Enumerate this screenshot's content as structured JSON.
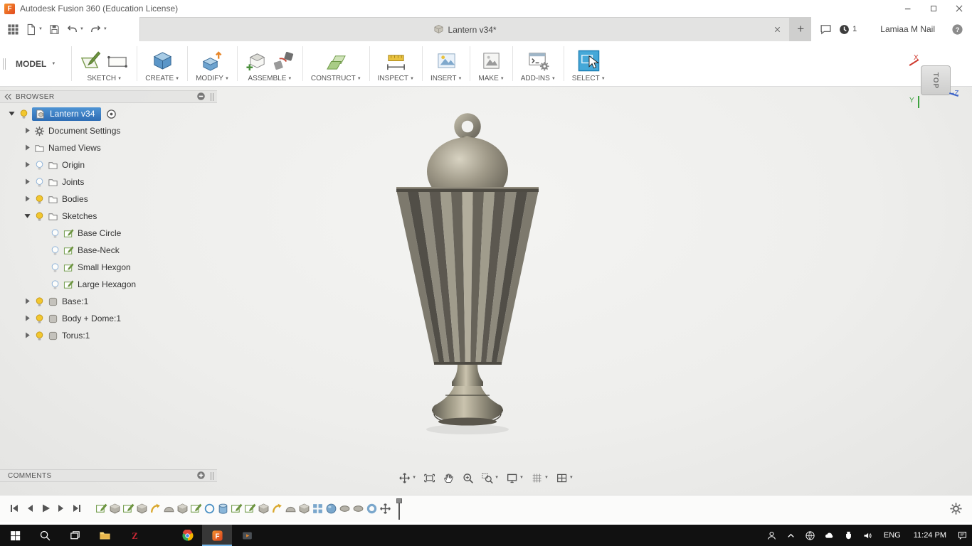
{
  "colors": {
    "fusion_orange": "#e8672c",
    "selection_blue": "#3a7cc0",
    "select_tool_blue": "#45a8d8",
    "taskbar_bg": "#111111"
  },
  "window": {
    "title": "Autodesk Fusion 360 (Education License)",
    "controls": [
      "minimize-icon",
      "maximize-icon",
      "close-icon"
    ]
  },
  "quickbar": {
    "icons": [
      {
        "icon": "app-grid-icon",
        "caret": false
      },
      {
        "icon": "file-icon",
        "caret": true
      },
      {
        "icon": "save-icon",
        "caret": false
      },
      {
        "icon": "undo-icon",
        "caret": true
      },
      {
        "icon": "redo-icon",
        "caret": true
      }
    ],
    "doc_tab": "Lantern v34*",
    "new_tab_label": "+",
    "job_count": "1",
    "user_name": "Lamiaa M Nail",
    "right_icons": [
      "comment-icon",
      "clock-icon",
      "help-icon"
    ]
  },
  "ribbon": {
    "workspace": "MODEL",
    "groups": [
      {
        "label": "SKETCH",
        "icons": [
          "sketch-icon",
          "rectangle-tool-icon"
        ],
        "active": false
      },
      {
        "label": "CREATE",
        "icons": [
          "box-icon"
        ],
        "active": false
      },
      {
        "label": "MODIFY",
        "icons": [
          "press-pull-icon"
        ],
        "active": false
      },
      {
        "label": "ASSEMBLE",
        "icons": [
          "new-component-icon",
          "joint-icon"
        ],
        "active": false
      },
      {
        "label": "CONSTRUCT",
        "icons": [
          "plane-icon"
        ],
        "active": false
      },
      {
        "label": "INSPECT",
        "icons": [
          "measure-icon"
        ],
        "active": false
      },
      {
        "label": "INSERT",
        "icons": [
          "canvas-icon"
        ],
        "active": false
      },
      {
        "label": "MAKE",
        "icons": [
          "make-icon"
        ],
        "active": false
      },
      {
        "label": "ADD-INS",
        "icons": [
          "scripts-icon"
        ],
        "active": false
      },
      {
        "label": "SELECT",
        "icons": [
          "select-icon"
        ],
        "active": true
      }
    ]
  },
  "browser": {
    "header": "BROWSER",
    "items": [
      {
        "label": "Lantern v34",
        "level": 0,
        "arrow": "down",
        "icons": [
          "bulb-on",
          "component"
        ],
        "selected": true
      },
      {
        "label": "Document Settings",
        "level": 1,
        "arrow": "right",
        "icons": [
          "gear"
        ]
      },
      {
        "label": "Named Views",
        "level": 1,
        "arrow": "right",
        "icons": [
          "folder"
        ]
      },
      {
        "label": "Origin",
        "level": 1,
        "arrow": "right",
        "icons": [
          "bulb-off",
          "folder"
        ]
      },
      {
        "label": "Joints",
        "level": 1,
        "arrow": "right",
        "icons": [
          "bulb-off",
          "folder"
        ]
      },
      {
        "label": "Bodies",
        "level": 1,
        "arrow": "right",
        "icons": [
          "bulb-on",
          "folder"
        ]
      },
      {
        "label": "Sketches",
        "level": 1,
        "arrow": "down",
        "icons": [
          "bulb-on",
          "folder"
        ]
      },
      {
        "label": "Base Circle",
        "level": 2,
        "arrow": null,
        "icons": [
          "bulb-off",
          "sketch-mini"
        ]
      },
      {
        "label": "Base-Neck",
        "level": 2,
        "arrow": null,
        "icons": [
          "bulb-off",
          "sketch-mini"
        ]
      },
      {
        "label": "Small Hexgon",
        "level": 2,
        "arrow": null,
        "icons": [
          "bulb-off",
          "sketch-mini"
        ]
      },
      {
        "label": "Large Hexagon",
        "level": 2,
        "arrow": null,
        "icons": [
          "bulb-off",
          "sketch-mini"
        ]
      },
      {
        "label": "Base:1",
        "level": 1,
        "arrow": "right",
        "icons": [
          "bulb-on",
          "body-mini"
        ]
      },
      {
        "label": "Body + Dome:1",
        "level": 1,
        "arrow": "right",
        "icons": [
          "bulb-on",
          "body-mini"
        ]
      },
      {
        "label": "Torus:1",
        "level": 1,
        "arrow": "right",
        "icons": [
          "bulb-on",
          "body-mini"
        ]
      }
    ]
  },
  "viewcube": {
    "face": "TOP",
    "axis_x": "X",
    "axis_y": "Y",
    "axis_z": "-Z"
  },
  "comments": {
    "header": "COMMENTS"
  },
  "navbar": {
    "items": [
      {
        "icon": "pan-icon",
        "caret": true
      },
      {
        "icon": "fit-icon",
        "caret": false
      },
      {
        "icon": "hand-icon",
        "caret": false
      },
      {
        "icon": "zoom-icon",
        "caret": false
      },
      {
        "icon": "zoom-window-icon",
        "caret": true
      },
      {
        "icon": "display-settings-icon",
        "caret": true
      },
      {
        "icon": "layout-grid-icon",
        "caret": true
      },
      {
        "icon": "viewports-icon",
        "caret": true
      }
    ]
  },
  "timeline": {
    "playback_icons": [
      "skip-start-icon",
      "step-back-icon",
      "play-icon",
      "step-forward-icon",
      "skip-end-icon"
    ],
    "features": [
      "sketch",
      "extrude",
      "sketch",
      "extrude",
      "sweep",
      "dome",
      "extrude",
      "sketch",
      "circle",
      "cylinder",
      "sketch",
      "sketch",
      "extrude",
      "sweep",
      "dome",
      "extrude",
      "pattern",
      "sphere",
      "disc",
      "disc",
      "torus",
      "move"
    ],
    "settings_icon": "gear-icon"
  },
  "taskbar": {
    "left_icons": [
      "start-icon",
      "search-icon",
      "taskview-icon",
      "explorer-icon",
      "zotero-icon"
    ],
    "apps": [
      {
        "icon": "chrome-icon",
        "active": false
      },
      {
        "icon": "fusion-icon",
        "active": true
      },
      {
        "icon": "media-player-icon",
        "active": false
      }
    ],
    "tray_icons": [
      "person-icon",
      "chevron-up-icon",
      "network-icon",
      "onedrive-icon",
      "usb-icon",
      "speaker-icon"
    ],
    "language": "ENG",
    "time": "11:24 PM",
    "far_right_icons": [
      "notifications-icon"
    ]
  }
}
